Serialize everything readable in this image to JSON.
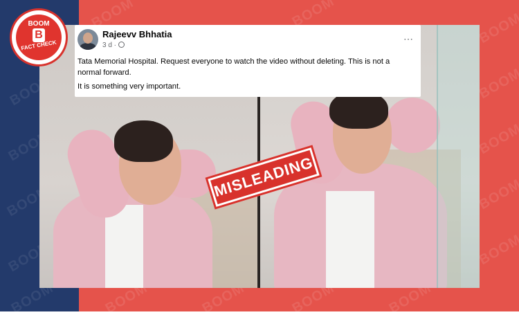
{
  "badge": {
    "top_text": "BOOM",
    "letter": "B",
    "bottom_text": "FACT CHECK"
  },
  "watermark_text": "BOOM",
  "post": {
    "poster_name": "Rajeevv Bhhatia",
    "timestamp": "3 d",
    "menu_icon": "⋯",
    "text_line_1": "Tata Memorial Hospital. Request everyone to watch the video without deleting.  This is not a normal forward.",
    "text_line_2": "It is something  very important."
  },
  "stamp": {
    "label": "MISLEADING"
  },
  "colors": {
    "navy": "#233a6b",
    "red": "#e5534b",
    "stamp_red": "#d8322c"
  }
}
